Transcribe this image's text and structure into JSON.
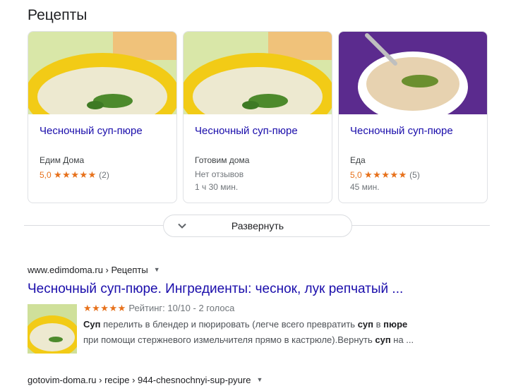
{
  "section": {
    "title": "Рецепты"
  },
  "cards": [
    {
      "title": "Чесночный суп-пюре",
      "source": "Едим Дома",
      "rating": "5,0",
      "stars": "★★★★★",
      "reviews": "(2)",
      "time": ""
    },
    {
      "title": "Чесночный суп-пюре",
      "source": "Готовим дома",
      "no_reviews": "Нет отзывов",
      "time": "1 ч 30 мин."
    },
    {
      "title": "Чесночный суп-пюре",
      "source": "Еда",
      "rating": "5,0",
      "stars": "★★★★★",
      "reviews": "(5)",
      "time": "45 мин."
    }
  ],
  "expand": {
    "label": "Развернуть",
    "icon": "chevron-down-icon"
  },
  "results": [
    {
      "breadcrumb": "www.edimdoma.ru › Рецепты",
      "title": "Чесночный суп-пюре. Ингредиенты: чеснок, лук репчатый ...",
      "stars": "★★★★★",
      "rating_text": "Рейтинг: 10/10 - 2 голоса",
      "snippet": {
        "l1_b1": "Суп",
        "l1_t1": " перелить в блендер и пюрировать (легче всего превратить ",
        "l1_b2": "суп",
        "l1_t2": " в ",
        "l1_b3": "пюре",
        "l2_t1": "при помощи стержневого измельчителя прямо в кастрюле).Вернуть ",
        "l2_b1": "суп",
        "l2_t2": " на ..."
      }
    },
    {
      "breadcrumb": "gotovim-doma.ru › recipe › 944-chesnochnyi-sup-pyure"
    }
  ],
  "colors": {
    "link": "#1a0dab",
    "star": "#e7711b",
    "muted": "#70757a",
    "border": "#dfe1e5"
  }
}
